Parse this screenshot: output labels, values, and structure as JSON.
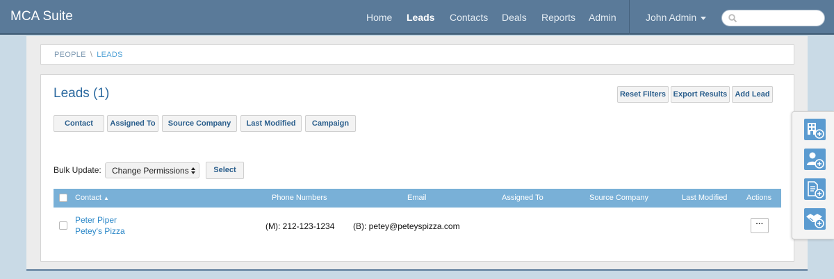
{
  "app": {
    "title": "MCA Suite"
  },
  "nav": {
    "items": [
      {
        "label": "Home",
        "active": false
      },
      {
        "label": "Leads",
        "active": true
      },
      {
        "label": "Contacts",
        "active": false
      },
      {
        "label": "Deals",
        "active": false
      },
      {
        "label": "Reports",
        "active": false
      },
      {
        "label": "Admin",
        "active": false
      }
    ],
    "user": "John Admin",
    "search_placeholder": ""
  },
  "breadcrumb": {
    "parent": "PEOPLE",
    "separator": "\\",
    "current": "LEADS"
  },
  "page": {
    "title": "Leads (1)"
  },
  "actions": {
    "reset": "Reset Filters",
    "export": "Export Results",
    "add": "Add Lead"
  },
  "filters": [
    "Contact",
    "Assigned To",
    "Source Company",
    "Last Modified",
    "Campaign"
  ],
  "bulk": {
    "label": "Bulk Update:",
    "selected": "Change Permissions",
    "button": "Select"
  },
  "table": {
    "columns": [
      "Contact",
      "Phone Numbers",
      "Email",
      "Assigned To",
      "Source Company",
      "Last Modified",
      "Actions"
    ],
    "sort_indicator": "▲",
    "rows": [
      {
        "name": "Peter Piper",
        "company": "Petey's Pizza",
        "phone": "(M): 212-123-1234",
        "email": "(B): petey@peteyspizza.com",
        "assigned_to": "",
        "source_company": "",
        "last_modified": "",
        "actions": "···"
      }
    ]
  },
  "side_tools": [
    "add-company-icon",
    "add-contact-icon",
    "add-document-icon",
    "add-deal-icon"
  ],
  "colors": {
    "navbar": "#5a7a99",
    "table_header": "#79b0d7",
    "link": "#2a87c8",
    "title": "#2c6aa0",
    "tool": "#5b9bd0"
  }
}
